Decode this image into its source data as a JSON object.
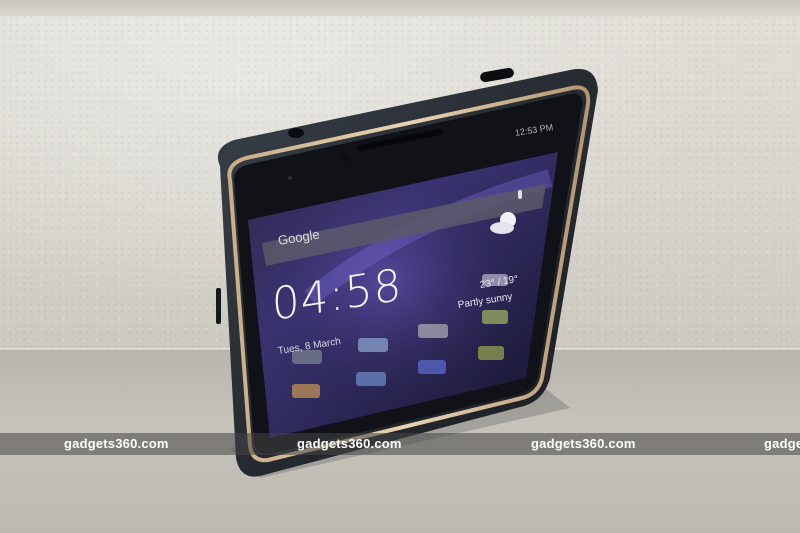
{
  "phone": {
    "status_time": "12:53 PM",
    "search_label": "Google",
    "clock": "04:58",
    "date": "Tues, 8 March",
    "temperature": "23° / 19°",
    "condition": "Partly sunny"
  },
  "watermark": {
    "text_1": "gadgets360.com",
    "text_2": "gadgets360.com",
    "text_3": "gadgets360.com",
    "text_4": "gadge"
  },
  "icons": [
    "weather-sun-cloud-icon",
    "mic-icon",
    "headphone-jack-icon",
    "usb-port-icon"
  ]
}
